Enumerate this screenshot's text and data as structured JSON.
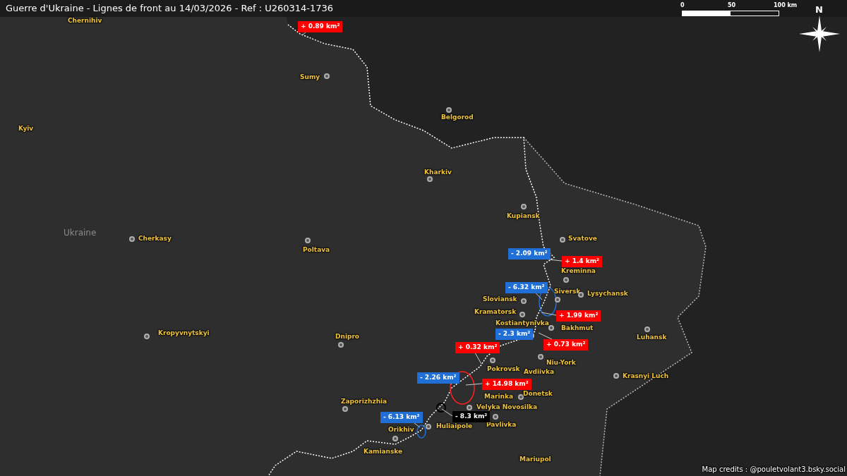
{
  "title": "Guerre d'Ukraine - Lignes de front au 14/03/2026 - Ref : U260314-1736",
  "scale_bar": {
    "labels": [
      "0",
      "50",
      "100 km"
    ]
  },
  "compass": {
    "label": "N"
  },
  "country_label": "Ukraine",
  "cities": [
    {
      "name": "Chernihiv"
    },
    {
      "name": "Sumy"
    },
    {
      "name": "Kyїv"
    },
    {
      "name": "Belgorod"
    },
    {
      "name": "Kharkiv"
    },
    {
      "name": "Kupiansk"
    },
    {
      "name": "Svatove"
    },
    {
      "name": "Kreminna"
    },
    {
      "name": "Siversk"
    },
    {
      "name": "Lysychansk"
    },
    {
      "name": "Sloviansk"
    },
    {
      "name": "Kramatorsk"
    },
    {
      "name": "Kostiantynivka"
    },
    {
      "name": "Bakhmut"
    },
    {
      "name": "Luhansk"
    },
    {
      "name": "Niu-York"
    },
    {
      "name": "Pokrovsk"
    },
    {
      "name": "Avdiivka"
    },
    {
      "name": "Marinka"
    },
    {
      "name": "Donetsk"
    },
    {
      "name": "Velyka Novosilka"
    },
    {
      "name": "Pavlivka"
    },
    {
      "name": "Huliaipole"
    },
    {
      "name": "Orikhiv"
    },
    {
      "name": "Kamianske"
    },
    {
      "name": "Mariupol"
    },
    {
      "name": "Dnipro"
    },
    {
      "name": "Zaporizhzhia"
    },
    {
      "name": "Kropyvnytskyi"
    },
    {
      "name": "Cherkasy"
    },
    {
      "name": "Poltava"
    },
    {
      "name": "Krasnyi Luch"
    }
  ],
  "area_changes": [
    {
      "value": "+ 0.89 km²",
      "color": "#ff0000"
    },
    {
      "value": "- 2.09 km²",
      "color": "#1f6fd6"
    },
    {
      "value": "+ 1.4 km²",
      "color": "#ff0000"
    },
    {
      "value": "- 6.32 km²",
      "color": "#1f6fd6"
    },
    {
      "value": "+ 1.99 km²",
      "color": "#ff0000"
    },
    {
      "value": "- 2.3 km²",
      "color": "#1f6fd6"
    },
    {
      "value": "+ 0.73 km²",
      "color": "#ff0000"
    },
    {
      "value": "+ 0.32 km²",
      "color": "#ff0000"
    },
    {
      "value": "- 2.26 km²",
      "color": "#1f6fd6"
    },
    {
      "value": "+ 14.98 km²",
      "color": "#ff0000"
    },
    {
      "value": "- 8.3 km²",
      "color": "#000000"
    },
    {
      "value": "- 6.13 km²",
      "color": "#1f6fd6"
    }
  ],
  "credits": "Map credits : @pouletvolant3.bsky.social"
}
